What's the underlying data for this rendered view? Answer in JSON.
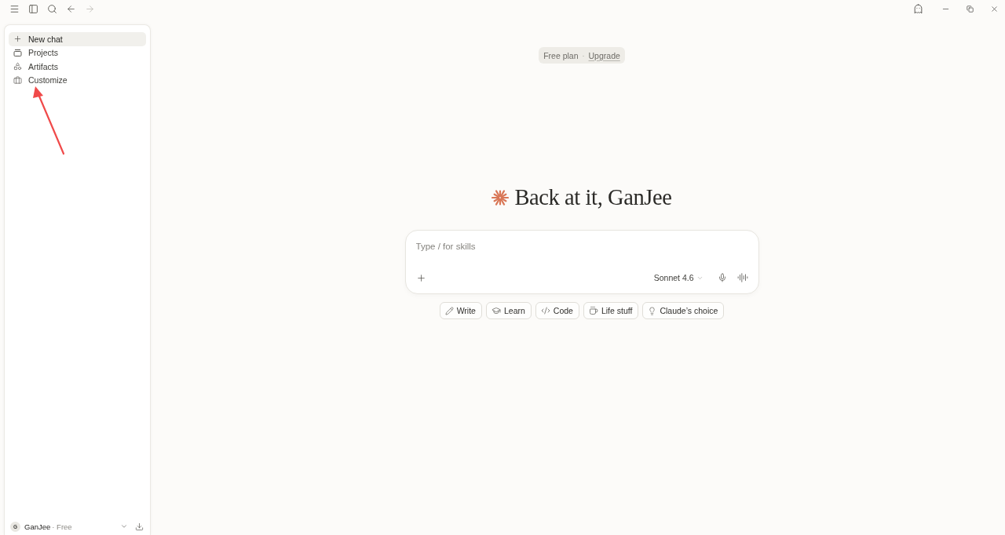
{
  "sidebar": {
    "items": [
      {
        "label": "New chat",
        "selected": true
      },
      {
        "label": "Projects",
        "selected": false
      },
      {
        "label": "Artifacts",
        "selected": false
      },
      {
        "label": "Customize",
        "selected": false
      }
    ],
    "user": {
      "initial": "G",
      "name": "GanJee",
      "plan": "· Free"
    }
  },
  "plan_badge": {
    "plan": "Free plan",
    "separator": "·",
    "link": "Upgrade"
  },
  "greeting": "Back at it, GanJee",
  "composer": {
    "placeholder": "Type / for skills",
    "model": "Sonnet 4.6"
  },
  "suggestions": [
    {
      "label": "Write"
    },
    {
      "label": "Learn"
    },
    {
      "label": "Code"
    },
    {
      "label": "Life stuff"
    },
    {
      "label": "Claude’s choice"
    }
  ]
}
